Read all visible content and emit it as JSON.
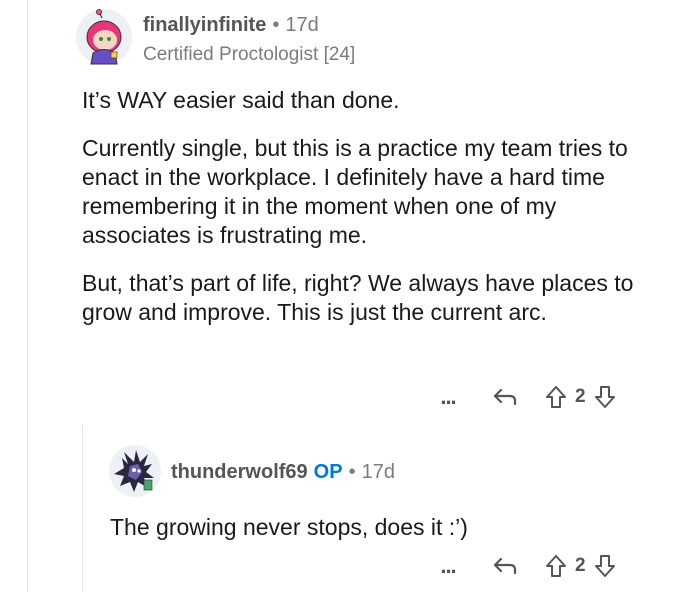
{
  "comment": {
    "author": "finallyinfinite",
    "time": "17d",
    "flair": "Certified Proctologist [24]",
    "paragraphs": [
      "It’s WAY easier said than done.",
      "Currently single, but this is a practice my team tries to enact in the workplace.  I definitely have a hard time remembering it in the moment when one of my associates is frustrating me.",
      "But, that’s part of life, right?  We always have places to grow and improve.  This is just the current arc."
    ],
    "more": "...",
    "score": "2",
    "avatar_icon": "snoo-avatar-pink-hair"
  },
  "reply": {
    "author": "thunderwolf69",
    "op_badge": "OP",
    "time": "17d",
    "text": "The growing never stops, does it :’)",
    "more": "...",
    "score": "2",
    "avatar_icon": "snoo-avatar-dark-creature"
  },
  "separator": "•",
  "colors": {
    "op": "#0079d3",
    "meta": "#7c7c7c",
    "text": "#1a1a1b"
  }
}
